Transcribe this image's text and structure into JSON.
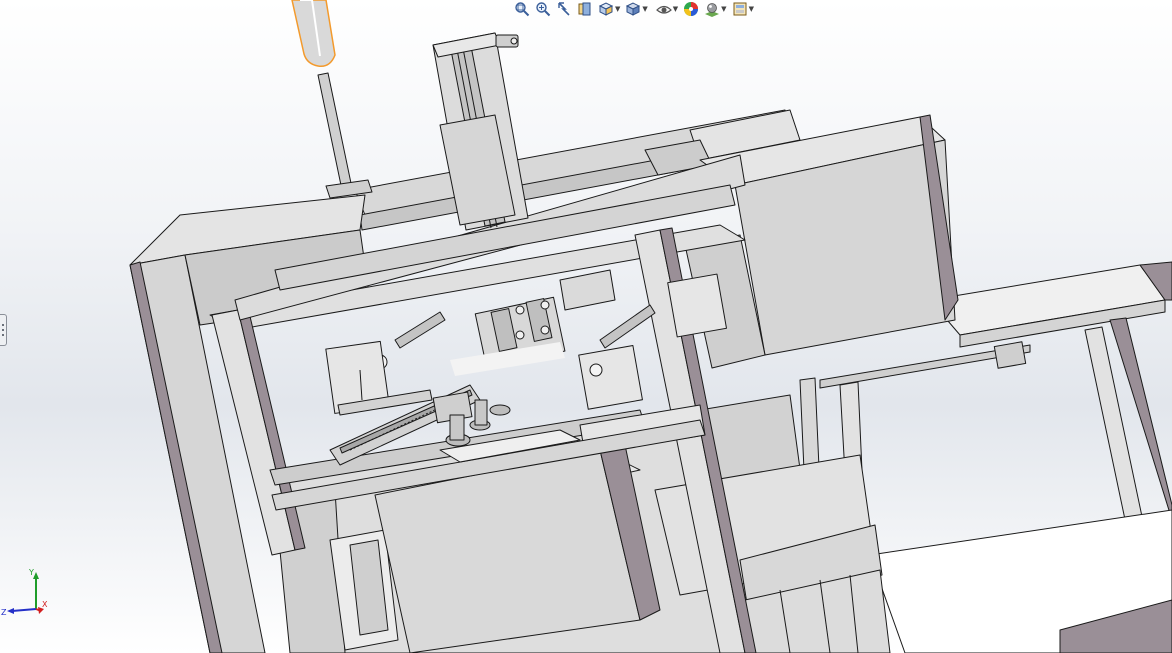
{
  "toolbar": {
    "items": [
      {
        "icon": "zoom-to-fit-icon",
        "dropdown": false
      },
      {
        "icon": "zoom-to-area-icon",
        "dropdown": false
      },
      {
        "icon": "previous-view-icon",
        "dropdown": false
      },
      {
        "icon": "section-view-icon",
        "dropdown": false
      },
      {
        "icon": "view-orientation-icon",
        "dropdown": true
      },
      {
        "icon": "display-style-icon",
        "dropdown": true
      },
      {
        "icon": "hide-show-items-icon",
        "dropdown": true
      },
      {
        "icon": "edit-appearance-icon",
        "dropdown": false
      },
      {
        "icon": "apply-scene-icon",
        "dropdown": true
      },
      {
        "icon": "view-settings-icon",
        "dropdown": true
      }
    ]
  },
  "triad": {
    "x_label": "X",
    "y_label": "Y",
    "z_label": "Z"
  },
  "colors": {
    "part_face": "#dcdcdc",
    "part_shadow": "#9a8f97",
    "edge": "#1a1a1a",
    "highlight": "#f39a2c",
    "x_axis": "#d21f1f",
    "y_axis": "#1f9d2a",
    "z_axis": "#2430c8"
  }
}
